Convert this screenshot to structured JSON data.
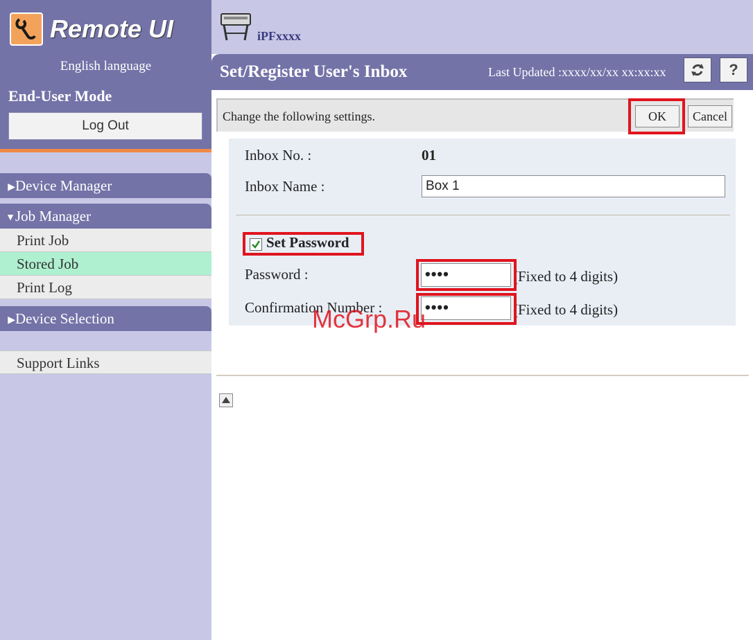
{
  "app": {
    "logo_text": "Remote UI",
    "language": "English language",
    "mode": "End-User Mode",
    "logout_label": "Log Out"
  },
  "sidebar": {
    "device_manager": "Device Manager",
    "job_manager": "Job Manager",
    "job_items": [
      "Print Job",
      "Stored Job",
      "Print Log"
    ],
    "active_item": "Stored Job",
    "device_selection": "Device Selection",
    "support_links": "Support Links"
  },
  "header": {
    "device_name": "iPFxxxx",
    "page_title": "Set/Register User's Inbox",
    "last_updated": "Last Updated :xxxx/xx/xx xx:xx:xx",
    "refresh_icon": "refresh-icon",
    "help_label": "?"
  },
  "instruction": {
    "text": "Change the following settings.",
    "ok_label": "OK",
    "cancel_label": "Cancel"
  },
  "form": {
    "inbox_no_label": "Inbox No. :",
    "inbox_no_value": "01",
    "inbox_name_label": "Inbox Name :",
    "inbox_name_value": "Box 1",
    "set_password_label": "Set Password",
    "set_password_checked": true,
    "password_label": "Password :",
    "password_value": "••••",
    "confirmation_label": "Confirmation Number :",
    "confirmation_value": "••••",
    "fixed_hint": "(Fixed to 4 digits)"
  },
  "watermark": "McGrp.Ru",
  "colors": {
    "header": "#7373a8",
    "sidebar": "#c8c8e6",
    "accent": "#f08a46",
    "highlight": "#e0141e",
    "active_item": "#aef0d0"
  }
}
